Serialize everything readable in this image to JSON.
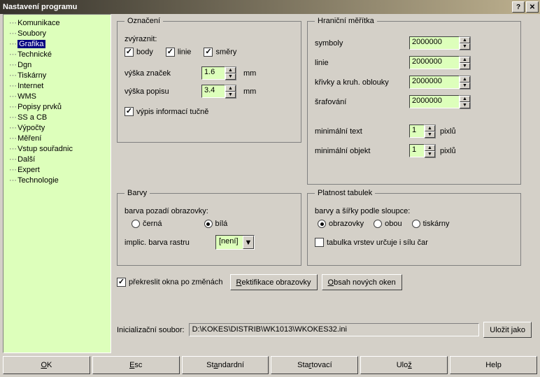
{
  "title": "Nastavení programu",
  "sidebar": {
    "items": [
      {
        "label": "Komunikace"
      },
      {
        "label": "Soubory"
      },
      {
        "label": "Grafika"
      },
      {
        "label": "Technické"
      },
      {
        "label": "Dgn"
      },
      {
        "label": "Tiskárny"
      },
      {
        "label": "Internet"
      },
      {
        "label": "WMS"
      },
      {
        "label": "Popisy prvků"
      },
      {
        "label": "SS a CB"
      },
      {
        "label": "Výpočty"
      },
      {
        "label": "Měření"
      },
      {
        "label": "Vstup souřadnic"
      },
      {
        "label": "Další"
      },
      {
        "label": "Expert"
      },
      {
        "label": "Technologie"
      }
    ]
  },
  "oznaceni": {
    "legend": "Označení",
    "zvyraznit": "zvýraznit:",
    "body": "body",
    "linie": "linie",
    "smery": "směry",
    "vyska_znacek": "výška značek",
    "vyska_znacek_val": "1.6",
    "vyska_popisu": "výška popisu",
    "vyska_popisu_val": "3.4",
    "mm": "mm",
    "vypis": "výpis informací tučně"
  },
  "meritka": {
    "legend": "Hraniční měřítka",
    "symboly": "symboly",
    "symboly_val": "2000000",
    "linie": "linie",
    "linie_val": "2000000",
    "krivky": "křivky a kruh. oblouky",
    "krivky_val": "2000000",
    "srafovani": "šrafování",
    "srafovani_val": "2000000",
    "min_text": "minimální text",
    "min_text_val": "1",
    "min_objekt": "minimální objekt",
    "min_objekt_val": "1",
    "pixlu": "pixlů"
  },
  "barvy": {
    "legend": "Barvy",
    "pozadi": "barva pozadí obrazovky:",
    "cerna": "černá",
    "bila": "bílá",
    "implic": "implic. barva rastru",
    "neni": "[není]"
  },
  "platnost": {
    "legend": "Platnost tabulek",
    "podle": "barvy a šířky podle sloupce:",
    "obrazovky": "obrazovky",
    "obou": "obou",
    "tiskarny": "tiskárny",
    "vrstev": "tabulka vrstev určuje i sílu čar"
  },
  "bottom": {
    "prekreslit": "překreslit okna po změnách",
    "rektifikace_pre": "R",
    "rektifikace": "ektifikace obrazovky",
    "obsah_pre": "O",
    "obsah": "bsah nových oken"
  },
  "init": {
    "label": "Inicializační soubor:",
    "path": "D:\\KOKES\\DISTRIB\\WK1013\\WKOKES32.ini",
    "save": "Uložit jako"
  },
  "buttons": {
    "ok_u": "O",
    "ok": "K",
    "esc_pre": "E",
    "esc": "sc",
    "std_pre": "St",
    "std_u": "a",
    "std_post": "ndardní",
    "start_pre": "Sta",
    "start_u": "r",
    "start_post": "tovací",
    "uloz_pre": "Ulo",
    "uloz_u": "ž",
    "help": "Help"
  }
}
